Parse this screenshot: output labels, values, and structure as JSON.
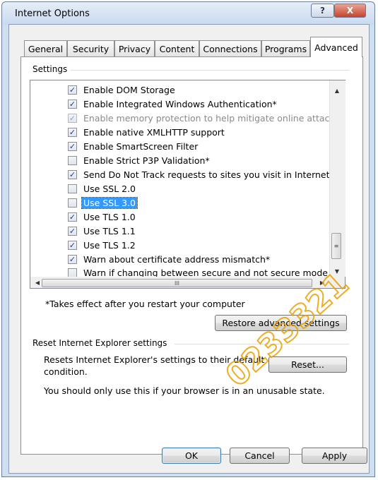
{
  "window": {
    "title": "Internet Options",
    "help_glyph": "?",
    "close_glyph": "X"
  },
  "tabs": [
    {
      "label": "General"
    },
    {
      "label": "Security"
    },
    {
      "label": "Privacy"
    },
    {
      "label": "Content"
    },
    {
      "label": "Connections"
    },
    {
      "label": "Programs"
    },
    {
      "label": "Advanced",
      "active": true
    }
  ],
  "settings": {
    "group_label": "Settings",
    "items": [
      {
        "label": "Enable DOM Storage",
        "checked": true
      },
      {
        "label": "Enable Integrated Windows Authentication*",
        "checked": true
      },
      {
        "label": "Enable memory protection to help mitigate online attacks*",
        "checked": true,
        "disabled": true
      },
      {
        "label": "Enable native XMLHTTP support",
        "checked": true
      },
      {
        "label": "Enable SmartScreen Filter",
        "checked": true
      },
      {
        "label": "Enable Strict P3P Validation*",
        "checked": false
      },
      {
        "label": "Send Do Not Track requests to sites you visit in Internet E",
        "checked": true
      },
      {
        "label": "Use SSL 2.0",
        "checked": false
      },
      {
        "label": "Use SSL 3.0",
        "checked": false,
        "selected": true
      },
      {
        "label": "Use TLS 1.0",
        "checked": true
      },
      {
        "label": "Use TLS 1.1",
        "checked": true
      },
      {
        "label": "Use TLS 1.2",
        "checked": true
      },
      {
        "label": "Warn about certificate address mismatch*",
        "checked": true
      },
      {
        "label": "Warn if changing between secure and not secure mode",
        "checked": false
      }
    ],
    "restart_note": "*Takes effect after you restart your computer",
    "restore_button": "Restore advanced settings",
    "scroll_thumb_glyph": "≡",
    "hscroll_thumb_glyph": "III"
  },
  "reset": {
    "group_label": "Reset Internet Explorer settings",
    "description_line1": "Resets Internet Explorer's settings to their default",
    "description_line2": "condition.",
    "reset_button": "Reset...",
    "warning": "You should only use this if your browser is in an unusable state."
  },
  "footer": {
    "ok": "OK",
    "cancel": "Cancel",
    "apply": "Apply"
  },
  "watermark": "0233321"
}
